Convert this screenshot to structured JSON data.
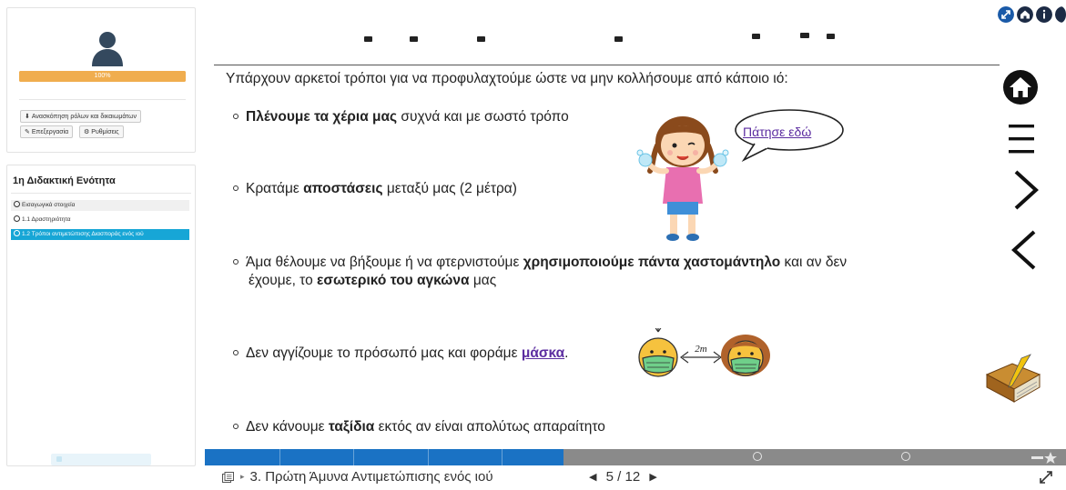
{
  "sidebar": {
    "progress_percent": 100,
    "progress_label": "100%",
    "buttons": {
      "roles": "Ανασκόπηση ρόλων και δικαιωμάτων",
      "edit": "Επεξεργασία",
      "settings": "Ρυθμίσεις"
    },
    "unit_title": "1η Διδακτική Ενότητα",
    "items": [
      {
        "label": "Εισαγωγικά στοιχεία"
      },
      {
        "label": "1.1 Δραστηριότητα"
      },
      {
        "label": "1.2 Τρόποι αντιμετώπισης Διασποράς ενός ιού"
      }
    ]
  },
  "slide": {
    "intro": "Υπάρχουν αρκετοί τρόποι για να προφυλαχτούμε ώστε να μην κολλήσουμε από κάποιο ιό:",
    "bullet1": {
      "bold": "Πλένουμε τα χέρια μας",
      "rest": " συχνά και με σωστό τρόπο"
    },
    "bullet2": {
      "pre": "Κρατάμε ",
      "bold": "αποστάσεις",
      "rest": " μεταξύ μας (2 μέτρα)"
    },
    "bullet3": {
      "pre": "Άμα θέλουμε να βήξουμε ή να φτερνιστούμε ",
      "bold1": "χρησιμοποιούμε πάντα χαστομάντηλο",
      "mid": " και αν δεν",
      "line2_pre": "έχουμε, το ",
      "bold2": "εσωτερικό του αγκώνα",
      "line2_rest": " μας"
    },
    "bullet4": {
      "pre": "Δεν αγγίζουμε το πρόσωπό μας και φοράμε ",
      "link": "μάσκα",
      "rest": "."
    },
    "bullet5": {
      "pre": "Δεν κάνουμε ",
      "bold": "ταξίδια",
      "rest": " εκτός αν είναι απολύτως απαραίτητο"
    },
    "speech_bubble": "Πάτησε εδώ",
    "distance_label": "2m"
  },
  "footer": {
    "chapter_title": "3. Πρώτη Άμυνα Αντιμετώπισης ενός ιού",
    "current_page": "5",
    "separator": "/",
    "total_pages": "12",
    "progress_fraction": 0.4167
  },
  "colors": {
    "accent": "#17a6d6",
    "progress_orange": "#f0ad4e",
    "bar_blue": "#1a72c4",
    "link_purple": "#5b2ca0"
  },
  "icons": {
    "top": [
      "expand-icon",
      "home-icon",
      "info-icon",
      "more-icon"
    ],
    "nav": [
      "home-icon",
      "menu-icon",
      "next-arrow-icon",
      "prev-arrow-icon"
    ]
  }
}
